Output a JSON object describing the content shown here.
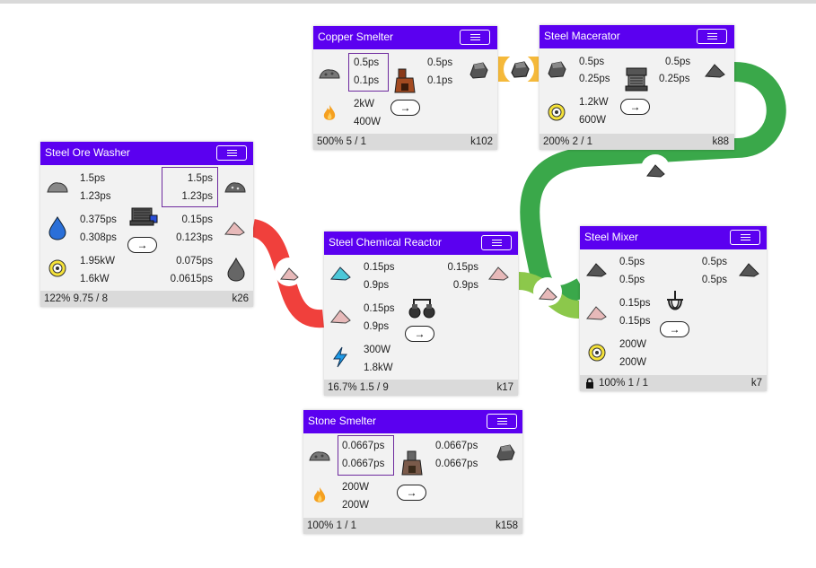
{
  "colors": {
    "header": "#5b00f0",
    "link_red": "#f0403c",
    "link_green": "#3aa84a",
    "link_light_green": "#8cc84b",
    "link_orange": "#f5b93a",
    "selected_rate_border": "#6e2a9e"
  },
  "nodes": {
    "copper_smelter": {
      "title": "Copper Smelter",
      "in_rate_1": "0.5ps",
      "in_rate_2": "0.1ps",
      "out_rate_1": "0.5ps",
      "out_rate_2": "0.1ps",
      "power_1": "2kW",
      "power_2": "400W",
      "footer_left": "500% 5 / 1",
      "footer_right": "k102",
      "icons": [
        "stone-ore-icon",
        "smelter-machine-icon",
        "steel-ingot-icon",
        "fire-icon"
      ]
    },
    "steel_macerator": {
      "title": "Steel Macerator",
      "in_rate_1": "0.5ps",
      "in_rate_2": "0.25ps",
      "out_rate_1": "0.5ps",
      "out_rate_2": "0.25ps",
      "power_1": "1.2kW",
      "power_2": "600W",
      "footer_left": "200% 2 / 1",
      "footer_right": "k88",
      "icons": [
        "steel-ingot-icon",
        "macerator-machine-icon",
        "steel-dust-icon",
        "energy-gear-icon"
      ]
    },
    "steel_ore_washer": {
      "title": "Steel Ore Washer",
      "in_rate_1": "1.5ps",
      "in_rate_2": "1.23ps",
      "out_rate_1": "1.5ps",
      "out_rate_2": "1.23ps",
      "water_rate_1": "0.375ps",
      "water_rate_2": "0.308ps",
      "byproduct_rate_1": "0.15ps",
      "byproduct_rate_2": "0.123ps",
      "power_1": "1.95kW",
      "power_2": "1.6kW",
      "stone_rate_1": "0.075ps",
      "stone_rate_2": "0.0615ps",
      "footer_left": "122% 9.75 / 8",
      "footer_right": "k26",
      "icons": [
        "crushed-ore-icon",
        "washer-machine-icon",
        "crushed-ore-out-icon",
        "water-drop-icon",
        "pink-dust-icon",
        "energy-gear-icon",
        "stone-dust-icon"
      ]
    },
    "steel_chemical_reactor": {
      "title": "Steel Chemical Reactor",
      "in_rate_1": "0.15ps",
      "in_rate_2": "0.9ps",
      "out_rate_1": "0.15ps",
      "out_rate_2": "0.9ps",
      "in2_rate_1": "0.15ps",
      "in2_rate_2": "0.9ps",
      "power_1": "300W",
      "power_2": "1.8kW",
      "footer_left": "16.7% 1.5 / 9",
      "footer_right": "k17",
      "icons": [
        "cyan-dust-icon",
        "pink-dust-out-icon",
        "pink-dust-icon",
        "reactor-machine-icon",
        "lightning-icon"
      ]
    },
    "steel_mixer": {
      "title": "Steel Mixer",
      "in_rate_1": "0.5ps",
      "in_rate_2": "0.5ps",
      "out_rate_1": "0.5ps",
      "out_rate_2": "0.5ps",
      "in2_rate_1": "0.15ps",
      "in2_rate_2": "0.15ps",
      "power_1": "200W",
      "power_2": "200W",
      "footer_left": "100% 1 / 1",
      "footer_right": "k7",
      "icons": [
        "steel-dust-icon",
        "steel-dust-out-icon",
        "pink-dust-icon",
        "mixer-machine-icon",
        "energy-gear-icon",
        "lock-icon"
      ]
    },
    "stone_smelter": {
      "title": "Stone Smelter",
      "in_rate_1": "0.0667ps",
      "in_rate_2": "0.0667ps",
      "out_rate_1": "0.0667ps",
      "out_rate_2": "0.0667ps",
      "power_1": "200W",
      "power_2": "200W",
      "footer_left": "100% 1 / 1",
      "footer_right": "k158",
      "icons": [
        "stone-ore-icon",
        "smelter-machine-icon",
        "steel-ingot-icon",
        "fire-icon"
      ]
    }
  },
  "arrow_label": "→"
}
